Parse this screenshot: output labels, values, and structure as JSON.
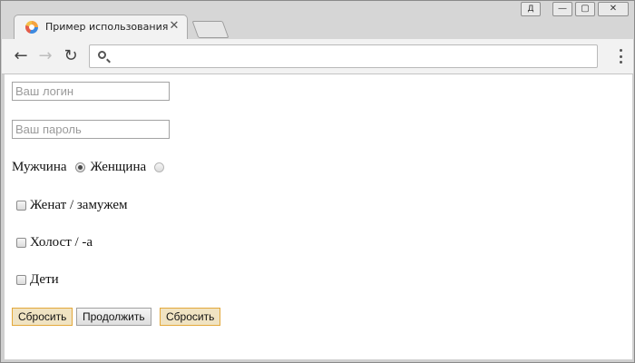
{
  "browser": {
    "tab_title": "Пример использования jQuery",
    "tab_close": "✕",
    "profile_label": "Д",
    "window_controls": {
      "minimize": "—",
      "maximize": "▢",
      "close": "✕"
    },
    "nav": {
      "back": "←",
      "forward": "→",
      "reload": "↻"
    }
  },
  "form": {
    "login_placeholder": "Ваш логин",
    "password_placeholder": "Ваш пароль",
    "gender": {
      "male_label": "Мужчина",
      "female_label": "Женщина",
      "selected": "male"
    },
    "checkboxes": [
      {
        "label": "Женат / замужем",
        "checked": false
      },
      {
        "label": "Холост / -а",
        "checked": false
      },
      {
        "label": "Дети",
        "checked": false
      }
    ],
    "buttons": {
      "reset_1": "Сбросить",
      "submit": "Продолжить",
      "reset_2": "Сбросить"
    }
  },
  "colors": {
    "reset_button_border": "#e3a83a",
    "reset_button_bg": "#f0e3c2"
  }
}
